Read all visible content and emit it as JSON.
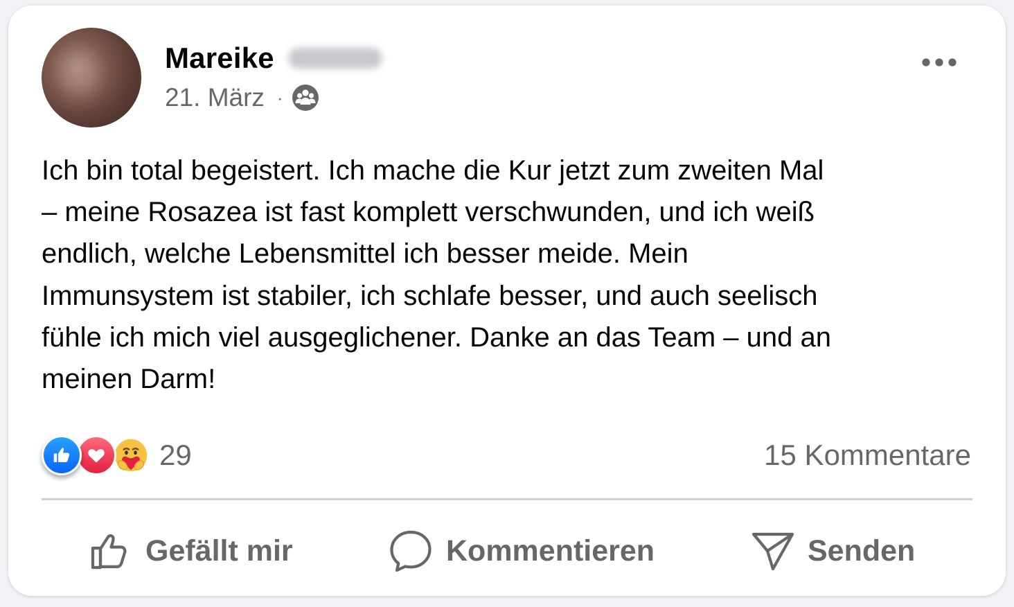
{
  "post": {
    "author_first_name": "Mareike",
    "date": "21. März",
    "separator": "·",
    "audience_icon": "group-icon",
    "text": "Ich bin total begeistert. Ich mache die Kur jetzt zum zweiten Mal\n– meine Rosazea ist fast komplett verschwunden, und ich weiß\nendlich, welche Lebensmittel ich besser meide. Mein\nImmunsystem ist stabiler, ich schlafe besser, und auch seelisch\nfühle ich mich viel ausgeglichener. Danke an das Team – und an\nmeinen Darm!"
  },
  "stats": {
    "reaction_icons": [
      "like-icon",
      "love-icon",
      "care-icon"
    ],
    "reaction_count": "29",
    "comments": "15 Kommentare"
  },
  "actions": {
    "like_label": "Gefällt mir",
    "comment_label": "Kommentieren",
    "send_label": "Senden"
  },
  "colors": {
    "text": "#050505",
    "secondary_text": "#65676b",
    "like_blue": "#0866ff",
    "love_red": "#e41e3f",
    "divider": "#ced0d4"
  }
}
